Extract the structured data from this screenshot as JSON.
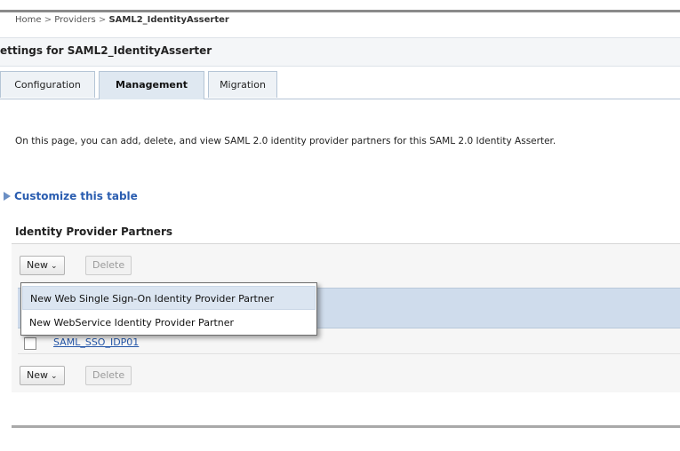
{
  "breadcrumb": {
    "home": "Home",
    "providers": "Providers",
    "current": "SAML2_IdentityAsserter",
    "separator": ">"
  },
  "settings_title": "ettings for SAML2_IdentityAsserter",
  "tabs": [
    {
      "label": "Configuration",
      "active": false
    },
    {
      "label": "Management",
      "active": true
    },
    {
      "label": "Migration",
      "active": false
    }
  ],
  "description": "On this page, you can add, delete, and view SAML 2.0 identity provider partners for this SAML 2.0 Identity Asserter.",
  "customize_link": "Customize this table",
  "section_title": "Identity Provider Partners",
  "toolbar": {
    "new_label": "New",
    "delete_label": "Delete"
  },
  "dropdown_menu": {
    "items": [
      "New Web Single Sign-On Identity Provider Partner",
      "New WebService Identity Provider Partner"
    ]
  },
  "table": {
    "rows": [
      {
        "name": "SAML_SSO_IDP01"
      }
    ]
  },
  "colors": {
    "link": "#2456a8",
    "selected_row": "#cfdcec",
    "active_tab": "#dfe8f1"
  }
}
